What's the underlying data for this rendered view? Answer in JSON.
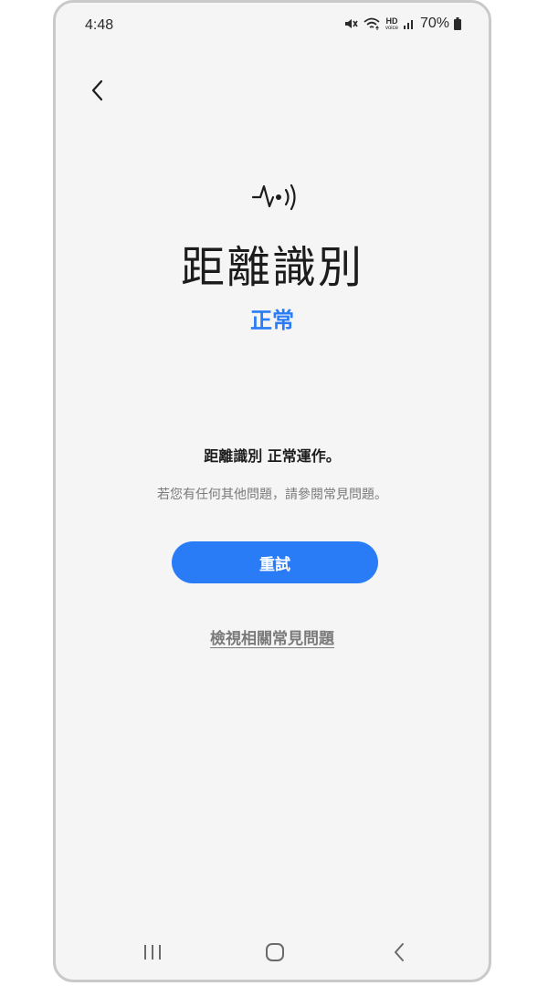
{
  "status_bar": {
    "time": "4:48",
    "hd_label": "HD",
    "voice_label": "voice",
    "battery": "70%"
  },
  "screen": {
    "title": "距離識別",
    "status": "正常",
    "message": "距離識別 正常運作。",
    "sub_message": "若您有任何其他問題，請參閱常見問題。",
    "retry_label": "重試",
    "faq_link": "檢視相關常見問題"
  },
  "icons": {
    "back": "chevron-left-icon",
    "feature": "pulse-signal-icon",
    "mute": "muted-speaker-icon",
    "wifi": "wifi-icon",
    "signal": "cell-signal-icon",
    "battery": "battery-icon"
  },
  "colors": {
    "accent": "#2a7cf6",
    "background": "#f5f5f5",
    "text_primary": "#1c1c1c",
    "text_secondary": "#7a7a7a"
  }
}
